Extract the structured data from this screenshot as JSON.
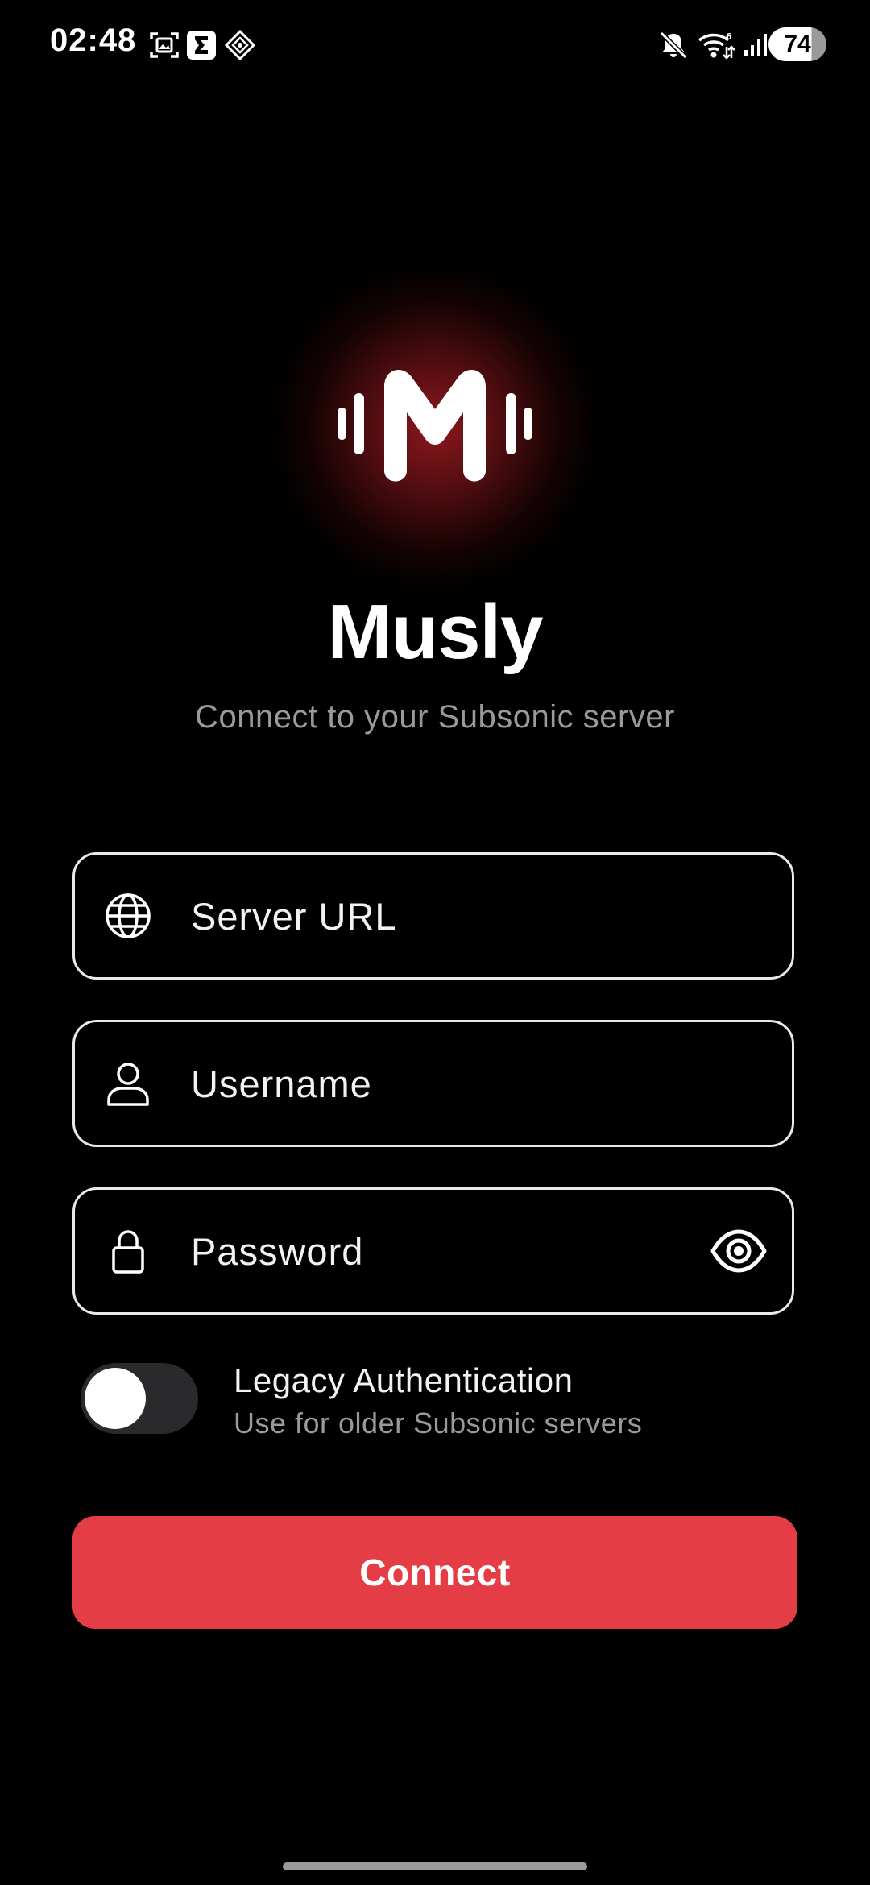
{
  "status_bar": {
    "time": "02:48",
    "battery_level": "74",
    "icons": [
      "screenshot-icon",
      "sigma-app-icon",
      "diamond-app-icon",
      "mute-icon",
      "wifi-icon",
      "signal-icon",
      "battery-icon"
    ]
  },
  "app": {
    "name": "Musly",
    "subtitle": "Connect to your Subsonic server",
    "accent_color": "#e53d45"
  },
  "form": {
    "server_url_placeholder": "Server URL",
    "username_placeholder": "Username",
    "password_placeholder": "Password",
    "server_url_value": "",
    "username_value": "",
    "password_value": ""
  },
  "legacy_auth": {
    "label": "Legacy Authentication",
    "description": "Use for older Subsonic servers",
    "enabled": false
  },
  "connect_button": {
    "label": "Connect"
  }
}
